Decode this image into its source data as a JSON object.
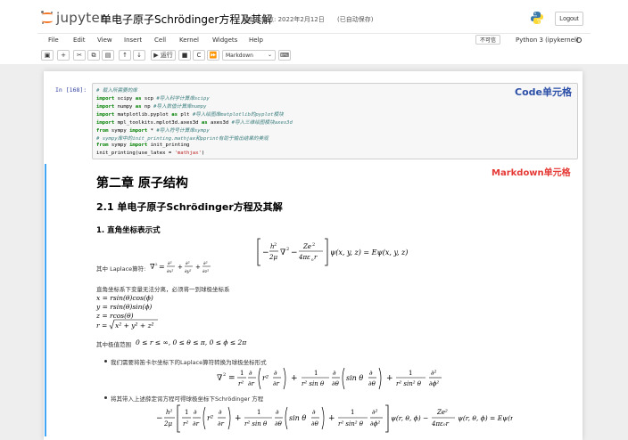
{
  "header": {
    "logo_text": "jupyter",
    "notebook_title": "单电子原子Schrödinger方程及其解",
    "checkpoint": "最新检查点: 2022年2月12日",
    "autosave": "(已自动保存)",
    "logout_label": "Logout"
  },
  "menu": {
    "items": [
      "File",
      "Edit",
      "View",
      "Insert",
      "Cell",
      "Kernel",
      "Widgets",
      "Help"
    ],
    "trusted": "不可信",
    "kernel": "Python 3 (ipykernel)"
  },
  "toolbar": {
    "run_label": "▶ 运行",
    "cell_type": "Markdown"
  },
  "code_cell": {
    "prompt": "In [168]:",
    "label": "Code单元格",
    "lines": [
      {
        "c": "# 载入所需要的库"
      },
      {
        "k": "import",
        "t": " scipy ",
        "k2": "as",
        "t2": " scp ",
        "c": "#导入科学计算库scipy"
      },
      {
        "k": "import",
        "t": " numpy ",
        "k2": "as",
        "t2": " np ",
        "c": "#导入数值计算库numpy"
      },
      {
        "k": "import",
        "t": " matplotlib.pyplot ",
        "k2": "as",
        "t2": " plt ",
        "c": "#导入绘图库matplotlib的pyplot模块"
      },
      {
        "k": "import",
        "t": " mpl_toolkits.mplot3d.axes3d ",
        "k2": "as",
        "t2": " axes3d ",
        "c": "#导入三维绘图模块axes3d"
      },
      {
        "k": "from",
        "t": " sympy ",
        "k2": "import",
        "t2": " * ",
        "c": "#导入符号计算库sympy"
      },
      {
        "c": "# sympy库中的init_printing.mathjax和pprint有助于输出结果的美观"
      },
      {
        "k": "from",
        "t": " sympy ",
        "k2": "import",
        "t2": " init_printing"
      },
      {
        "t": "init_printing(use_latex = ",
        "s": "'mathjax'",
        "t2": ")"
      }
    ]
  },
  "markdown_cell": {
    "label": "Markdown单元格",
    "h1": "第二章 原子结构",
    "h2": "2.1 单电子原子Schrödinger方程及其解",
    "h3": "1. 直角坐标表示式",
    "laplace_intro": "其中 Laplace算符:",
    "coords_intro": "直角坐标系下变量无法分离，必须将一到球极坐标系",
    "coords": [
      "x = rsin(θ)cos(ϕ)",
      "y = rsin(θ)sin(ϕ)",
      "z = rcos(θ)"
    ],
    "range_intro": "其中极值范围",
    "range_expr": "0 ≤ r ≤ ∞, 0 ≤ θ ≤ π, 0 ≤ ϕ ≤ 2π",
    "bullet1": "我们需要将笛卡尔坐标下的Laplace算符转换为球极坐标形式",
    "bullet2": "将其带入上述薛定谔方程可得球极坐标下Schrödinger 方程"
  }
}
